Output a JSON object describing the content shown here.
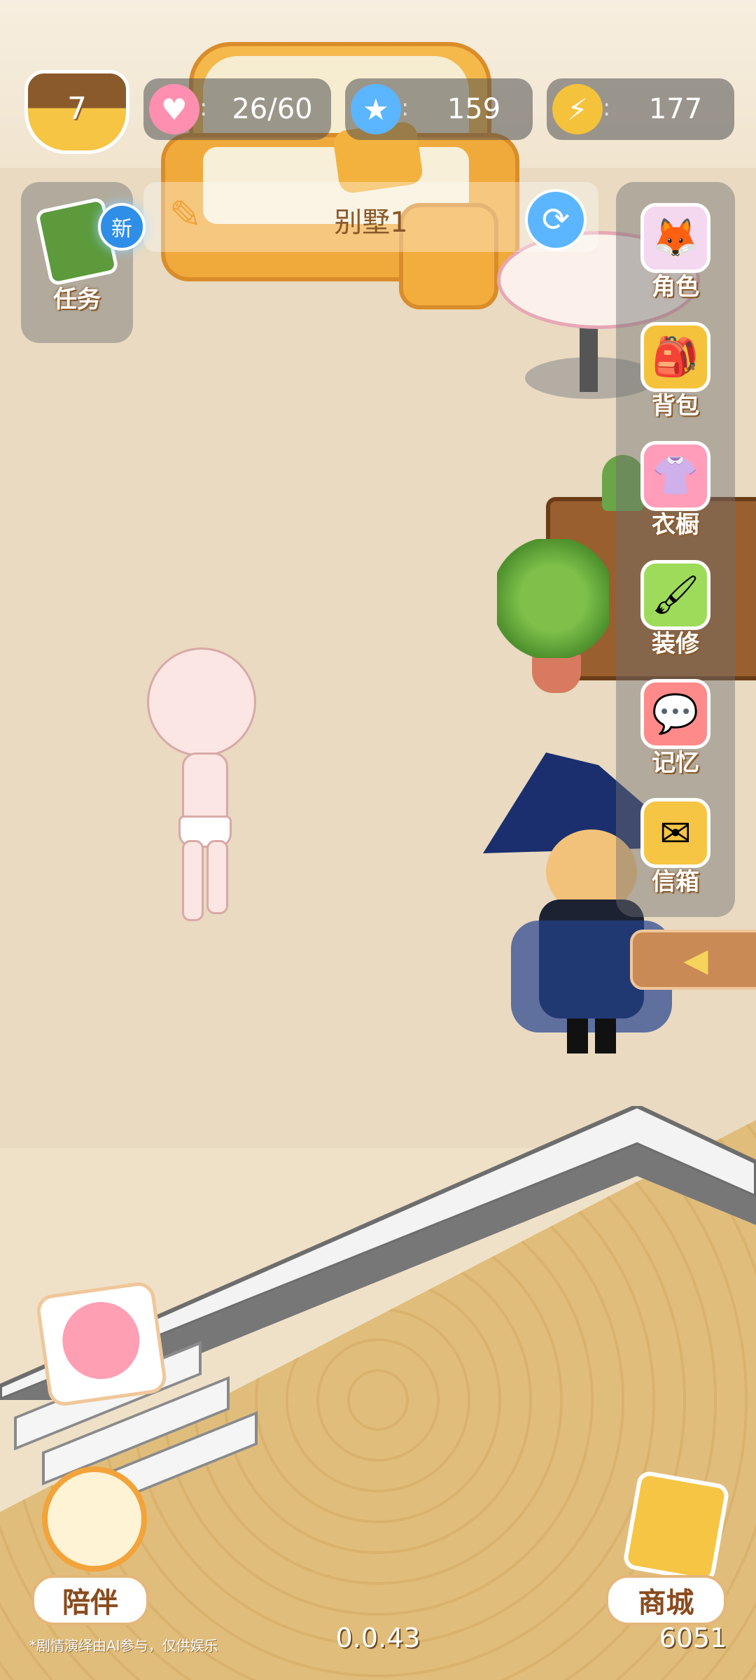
{
  "hud": {
    "level": "7",
    "hearts": "26/60",
    "stars": "159",
    "energy": "177"
  },
  "room": {
    "name": "别墅1",
    "new_badge": "新"
  },
  "tasks_label": "任务",
  "side_menu": [
    {
      "label": "角色",
      "icon": "character-icon"
    },
    {
      "label": "背包",
      "icon": "backpack-icon"
    },
    {
      "label": "衣橱",
      "icon": "wardrobe-icon"
    },
    {
      "label": "装修",
      "icon": "decorate-icon"
    },
    {
      "label": "记忆",
      "icon": "memory-icon"
    },
    {
      "label": "信箱",
      "icon": "mailbox-icon"
    }
  ],
  "bottom": {
    "companion_label": "陪伴",
    "shop_label": "商城",
    "disclaimer": "*剧情演绎由AI参与，仅供娱乐",
    "version": "0.0.43",
    "build": "6051"
  },
  "colors": {
    "accent": "#e5b67a",
    "panel": "#6e6e6e",
    "floor": "#e9dac1"
  }
}
